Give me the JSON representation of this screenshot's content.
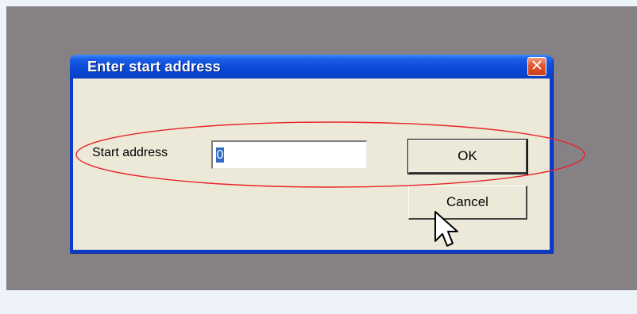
{
  "dialog": {
    "title": "Enter start address",
    "close_glyph": "✕",
    "field_label": "Start address",
    "address_value": "0",
    "ok_label": "OK",
    "cancel_label": "Cancel"
  },
  "icons": {
    "close": "close-icon",
    "cursor": "mouse-pointer-icon"
  },
  "colors": {
    "titlebar": "#0a44cf",
    "dialog_face": "#ece9d8",
    "backdrop": "#858184",
    "highlight": "#e8242a",
    "close_button": "#e2552c",
    "selection": "#316ac5"
  }
}
